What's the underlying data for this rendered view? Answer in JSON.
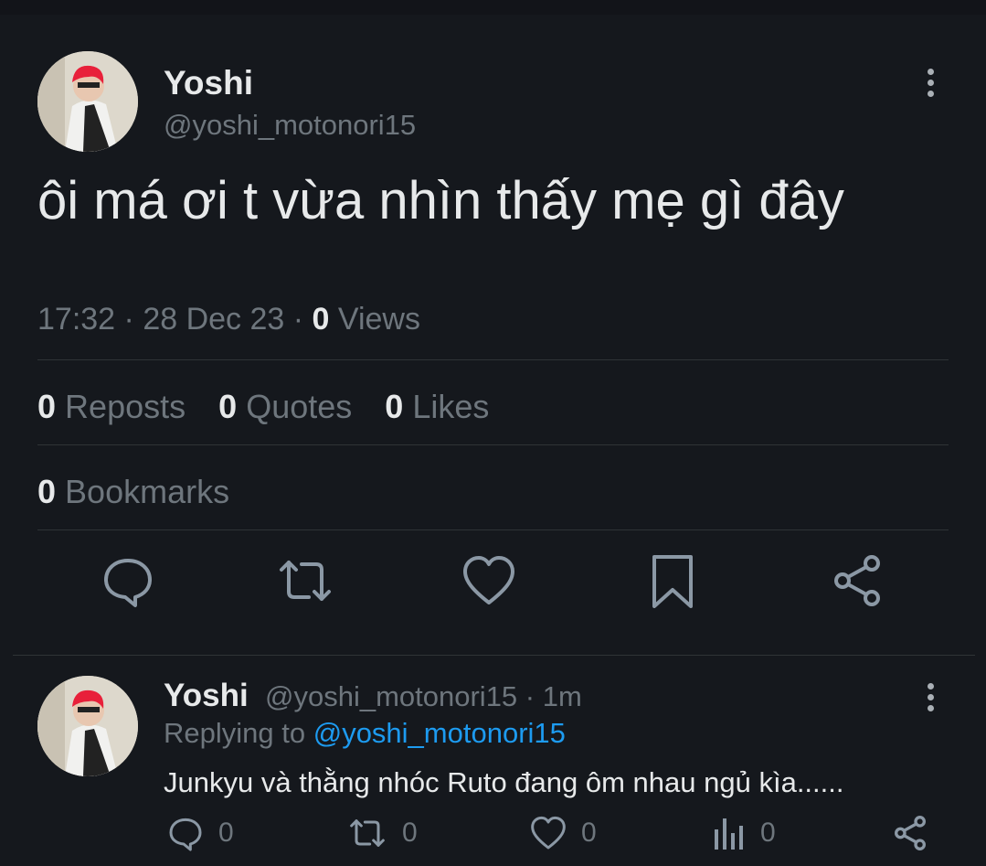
{
  "tweet": {
    "author_name": "Yoshi",
    "author_handle": "@yoshi_motonori15",
    "text": "ôi má ơi t vừa nhìn thấy mẹ gì đây",
    "time": "17:32",
    "date": "28 Dec 23",
    "views_count": "0",
    "views_label": "Views",
    "stats": {
      "reposts_count": "0",
      "reposts_label": "Reposts",
      "quotes_count": "0",
      "quotes_label": "Quotes",
      "likes_count": "0",
      "likes_label": "Likes",
      "bookmarks_count": "0",
      "bookmarks_label": "Bookmarks"
    },
    "actions": [
      "reply-icon",
      "repost-icon",
      "like-icon",
      "bookmark-icon",
      "share-icon"
    ]
  },
  "reply": {
    "author_name": "Yoshi",
    "author_handle": "@yoshi_motonori15",
    "time_ago": "1m",
    "replying_prefix": "Replying to",
    "replying_to": "@yoshi_motonori15",
    "text": "Junkyu và thằng nhóc Ruto đang ôm nhau ngủ kìa......",
    "counts": {
      "replies": "0",
      "reposts": "0",
      "likes": "0",
      "views": "0"
    }
  },
  "colors": {
    "background": "#15181d",
    "link": "#1d9bf0",
    "muted": "#6e767d",
    "divider": "#2f3336"
  }
}
